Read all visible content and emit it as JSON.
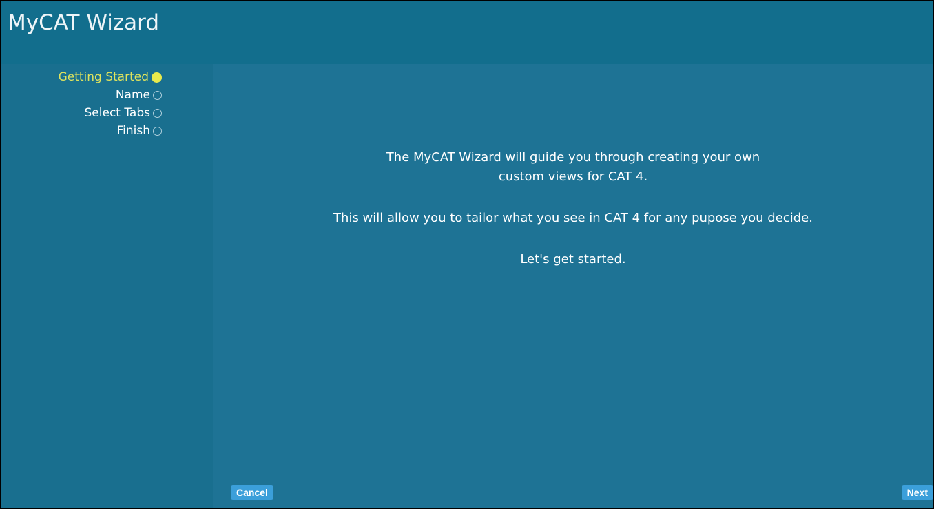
{
  "window": {
    "title": "MyCAT Wizard"
  },
  "steps": [
    {
      "label": "Getting Started",
      "state": "active"
    },
    {
      "label": "Name",
      "state": "pending"
    },
    {
      "label": "Select Tabs",
      "state": "pending"
    },
    {
      "label": "Finish",
      "state": "pending"
    }
  ],
  "content": {
    "paragraph1": "The MyCAT Wizard will guide you through creating your own custom views for CAT 4.",
    "paragraph2": "This will allow you to tailor what you see in CAT 4 for any pupose you decide.",
    "paragraph3": "Let's get started."
  },
  "buttons": {
    "cancel_label": "Cancel",
    "next_label": "Next"
  },
  "colors": {
    "title_bar": "#126e8d",
    "sidebar": "#196f8f",
    "content_panel": "#1e7395",
    "active_step": "#dfe35d",
    "button": "#3b9fda"
  }
}
